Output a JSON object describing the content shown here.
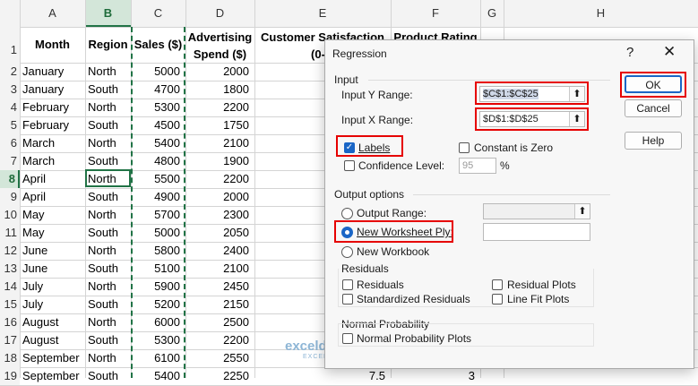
{
  "sheet": {
    "columns": [
      "A",
      "B",
      "C",
      "D",
      "E",
      "F",
      "G",
      "H"
    ],
    "selected_column": "B",
    "headers": {
      "month": "Month",
      "region": "Region",
      "sales": "Sales ($)",
      "advertising_1": "Advertising",
      "advertising_2": "Spend ($)",
      "customer_1": "Customer Satisfaction",
      "customer_2": "(0-",
      "product_1": "Product Rating"
    },
    "row_numbers": [
      "1",
      "2",
      "3",
      "4",
      "5",
      "6",
      "7",
      "8",
      "9",
      "10",
      "11",
      "12",
      "13",
      "14",
      "15",
      "16",
      "17",
      "18",
      "19"
    ],
    "rows": [
      {
        "month": "January",
        "region": "North",
        "sales": "5000",
        "adv": "2000"
      },
      {
        "month": "January",
        "region": "South",
        "sales": "4700",
        "adv": "1800"
      },
      {
        "month": "February",
        "region": "North",
        "sales": "5300",
        "adv": "2200"
      },
      {
        "month": "February",
        "region": "South",
        "sales": "4500",
        "adv": "1750"
      },
      {
        "month": "March",
        "region": "North",
        "sales": "5400",
        "adv": "2100"
      },
      {
        "month": "March",
        "region": "South",
        "sales": "4800",
        "adv": "1900"
      },
      {
        "month": "April",
        "region": "North",
        "sales": "5500",
        "adv": "2200"
      },
      {
        "month": "April",
        "region": "South",
        "sales": "4900",
        "adv": "2000"
      },
      {
        "month": "May",
        "region": "North",
        "sales": "5700",
        "adv": "2300"
      },
      {
        "month": "May",
        "region": "South",
        "sales": "5000",
        "adv": "2050"
      },
      {
        "month": "June",
        "region": "North",
        "sales": "5800",
        "adv": "2400"
      },
      {
        "month": "June",
        "region": "South",
        "sales": "5100",
        "adv": "2100"
      },
      {
        "month": "July",
        "region": "North",
        "sales": "5900",
        "adv": "2450"
      },
      {
        "month": "July",
        "region": "South",
        "sales": "5200",
        "adv": "2150"
      },
      {
        "month": "August",
        "region": "North",
        "sales": "6000",
        "adv": "2500"
      },
      {
        "month": "August",
        "region": "South",
        "sales": "5300",
        "adv": "2200"
      },
      {
        "month": "September",
        "region": "North",
        "sales": "6100",
        "adv": "2550"
      },
      {
        "month": "September",
        "region": "South",
        "sales": "5400",
        "adv": "2250",
        "extra_e": "7.5",
        "extra_f": "3"
      }
    ]
  },
  "dialog": {
    "title": "Regression",
    "help_glyph": "?",
    "close_glyph": "✕",
    "input_group": "Input",
    "input_y_label": "Input Y Range:",
    "input_y_value": "$C$1:$C$25",
    "input_x_label": "Input X Range:",
    "input_x_value": "$D$1:$D$25",
    "labels_label": "Labels",
    "labels_checked": true,
    "constant_zero_label": "Constant is Zero",
    "confidence_label": "Confidence Level:",
    "confidence_value": "95",
    "percent": "%",
    "output_group": "Output options",
    "output_range_label": "Output Range:",
    "new_ply_label": "New Worksheet Ply:",
    "new_workbook_label": "New Workbook",
    "residuals_group": "Residuals",
    "residuals_label": "Residuals",
    "std_residuals_label": "Standardized Residuals",
    "residual_plots_label": "Residual Plots",
    "line_fit_label": "Line Fit Plots",
    "normal_group": "Normal Probability",
    "normal_plots_label": "Normal Probability Plots",
    "ok_label": "OK",
    "cancel_label": "Cancel",
    "help_label": "Help",
    "ref_glyph": "⬆"
  },
  "watermark": {
    "name": "exceldemy",
    "tagline": "EXCEL · DATA · BI"
  },
  "colors": {
    "highlight": "#e60000",
    "accent": "#1a66c6",
    "excel_green": "#217346"
  }
}
